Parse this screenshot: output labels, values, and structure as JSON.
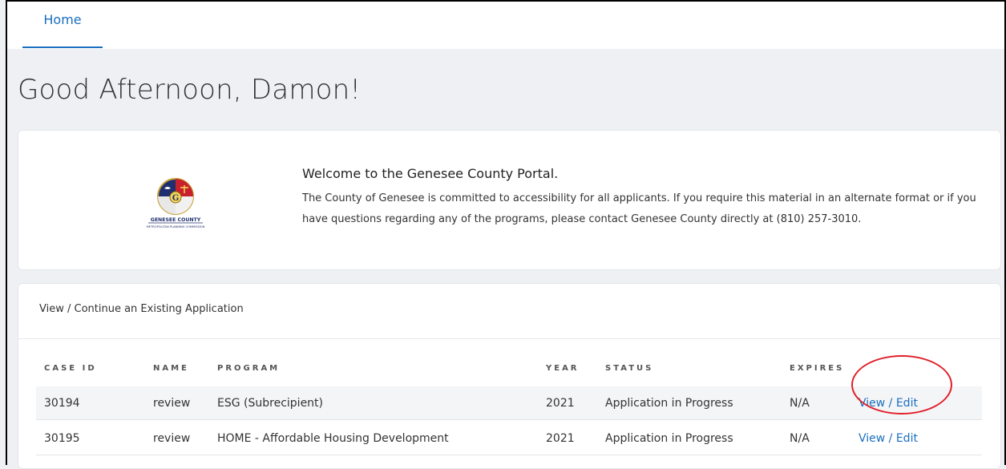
{
  "nav": {
    "home_label": "Home"
  },
  "greeting": "Good Afternoon, Damon!",
  "welcome": {
    "logo_text": "GENESEE COUNTY",
    "logo_subtext": "METROPOLITAN PLANNING COMMISSION",
    "title": "Welcome to the Genesee County Portal.",
    "body": "The County of Genesee is committed to accessibility for all applicants. If you require this material in an alternate format or if you have questions regarding any of the programs, please contact Genesee County directly at (810) 257-3010."
  },
  "applications": {
    "heading": "View / Continue an Existing Application",
    "columns": [
      "CASE ID",
      "NAME",
      "PROGRAM",
      "YEAR",
      "STATUS",
      "EXPIRES"
    ],
    "rows": [
      {
        "case_id": "30194",
        "name": "review",
        "program": "ESG (Subrecipient)",
        "year": "2021",
        "status": "Application in Progress",
        "expires": "N/A",
        "action": "View / Edit"
      },
      {
        "case_id": "30195",
        "name": "review",
        "program": "HOME - Affordable Housing Development",
        "year": "2021",
        "status": "Application in Progress",
        "expires": "N/A",
        "action": "View / Edit"
      }
    ]
  },
  "colors": {
    "accent": "#1a6fbf",
    "annotation": "#e0202a",
    "background": "#eef0f3"
  }
}
